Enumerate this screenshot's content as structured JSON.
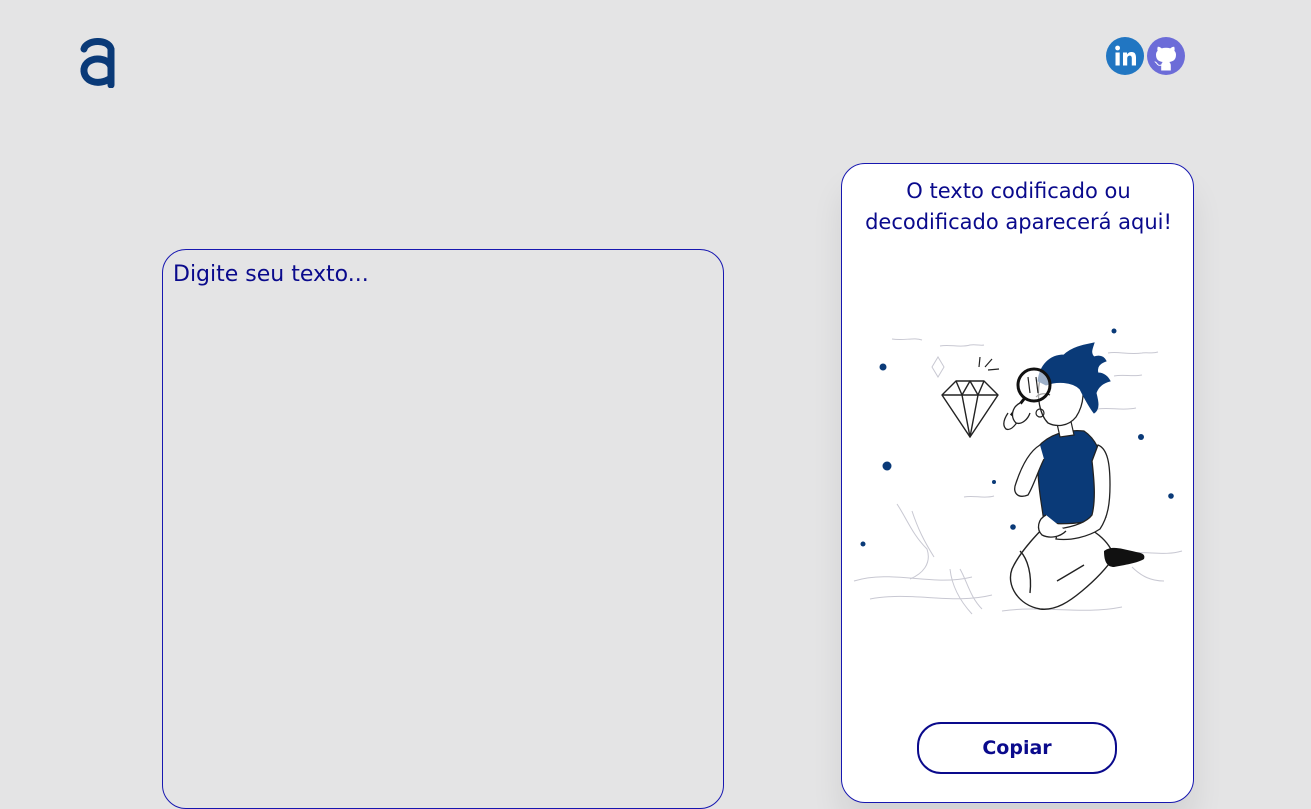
{
  "header": {
    "logo_letter": "a",
    "social_icons": [
      "linkedin-icon",
      "github-icon"
    ]
  },
  "input": {
    "placeholder": "Digite seu texto..."
  },
  "output": {
    "message": "O texto codificado ou decodificado aparecerá aqui!",
    "copy_label": "Copiar"
  },
  "colors": {
    "background": "#e4e4e5",
    "text": "#0a0a8c",
    "logo": "#0a3a78",
    "linkedin": "#2176c2",
    "github": "#6c6cd8",
    "card": "#ffffff",
    "illustration_blue": "#0a3a78"
  }
}
